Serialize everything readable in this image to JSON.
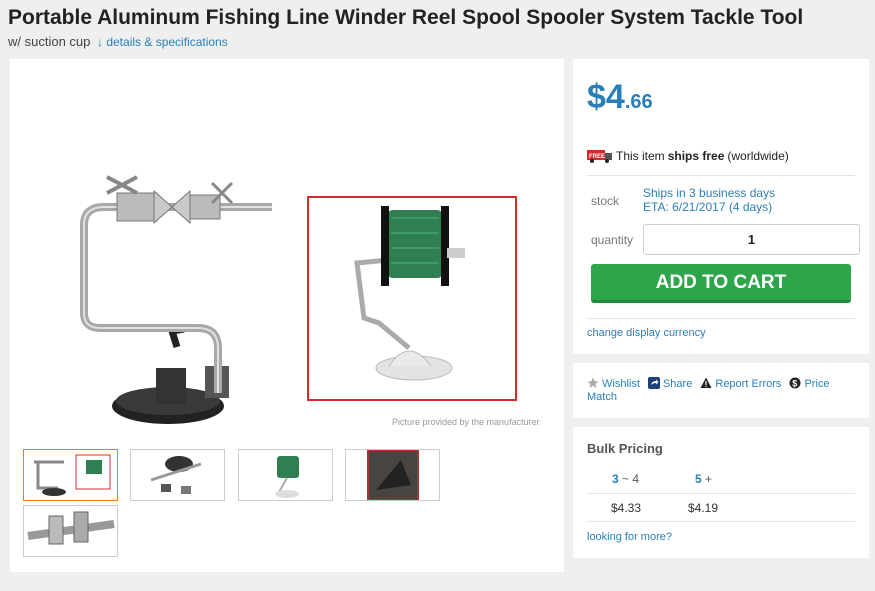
{
  "product": {
    "title": "Portable Aluminum Fishing Line Winder Reel Spool Spooler System Tackle Tool",
    "subtitle": "w/ suction cup",
    "specs_link": "↓ details & specifications",
    "image_caption": "Picture provided by the manufacturer"
  },
  "pricing": {
    "dollars": "$4",
    "cents": ".66",
    "ship_prefix": "This item",
    "ship_bold": "ships free",
    "ship_suffix": "(worldwide)",
    "free_badge": "FREE"
  },
  "stock": {
    "label": "stock",
    "ship_days": "Ships in 3 business days",
    "eta": "ETA: 6/21/2017 (4 days)"
  },
  "quantity": {
    "label": "quantity",
    "value": "1"
  },
  "cart": {
    "button_label": "ADD TO CART",
    "currency_link": "change display currency"
  },
  "actions": {
    "wishlist": "Wishlist",
    "share": "Share",
    "report": "Report Errors",
    "price_match": "Price Match"
  },
  "bulk": {
    "title": "Bulk Pricing",
    "tiers": [
      {
        "qty_from": "3",
        "sep": "~",
        "qty_to": "4",
        "price": "$4.33"
      },
      {
        "qty_from": "5",
        "sep": "+",
        "qty_to": "",
        "price": "$4.19"
      }
    ],
    "more_link": "looking for more?"
  },
  "colors": {
    "accent": "#2a7fb8",
    "cart_green": "#2fa54b",
    "inset_border": "#d32b2b",
    "active_thumb": "#e67e22"
  }
}
